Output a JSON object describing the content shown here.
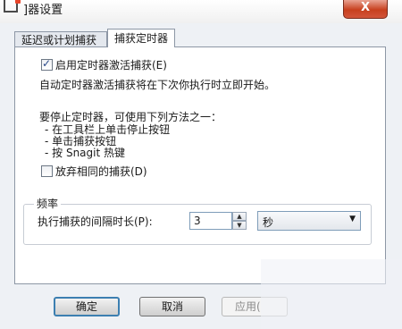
{
  "window": {
    "title": "]器设置",
    "close_label": "X"
  },
  "tabs": [
    {
      "label": "延迟或计划捕获",
      "active": false
    },
    {
      "label": "捕获定时器",
      "active": true
    }
  ],
  "timer": {
    "enable_checkbox_label": "启用定时器激活捕获(E)",
    "enable_checked": true,
    "description": "自动定时器激活捕获将在下次你执行时立即开始。",
    "stop_intro": "要停止定时器，可使用下列方法之一：",
    "stop_methods": [
      "- 在工具栏上单击停止按钮",
      "- 单击捕获按钮",
      "- 按 Snagit 热键"
    ],
    "discard_checkbox_label": "放弃相同的捕获(D)",
    "discard_checked": false
  },
  "frequency": {
    "group_title": "频率",
    "interval_label": "执行捕获的间隔时长(P):",
    "interval_value": "3",
    "unit_selected": "秒"
  },
  "buttons": {
    "ok": "确定",
    "cancel": "取消",
    "apply": "应用("
  }
}
